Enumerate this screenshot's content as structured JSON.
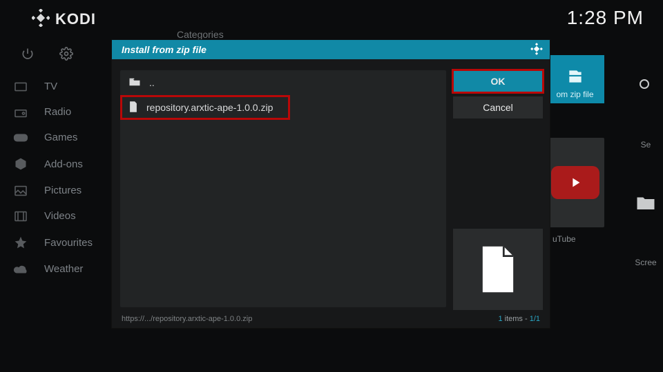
{
  "app": {
    "name": "KODI",
    "clock": "1:28 PM"
  },
  "categories_label": "Categories",
  "sidebar": {
    "items": [
      {
        "label": "TV"
      },
      {
        "label": "Radio"
      },
      {
        "label": "Games"
      },
      {
        "label": "Add-ons"
      },
      {
        "label": "Pictures"
      },
      {
        "label": "Videos"
      },
      {
        "label": "Favourites"
      },
      {
        "label": "Weather"
      }
    ]
  },
  "bg": {
    "install_tile_suffix": "om zip file",
    "youtube_label": "uTube",
    "right_labels": {
      "top": "Se",
      "bottom": "Scree"
    }
  },
  "dialog": {
    "title": "Install from zip file",
    "parent_label": "..",
    "file_label": "repository.arxtic-ape-1.0.0.zip",
    "ok_label": "OK",
    "cancel_label": "Cancel",
    "path": "https://.../repository.arxtic-ape-1.0.0.zip",
    "count_prefix": "1",
    "count_items": " items - ",
    "count_pos": "1/1"
  }
}
